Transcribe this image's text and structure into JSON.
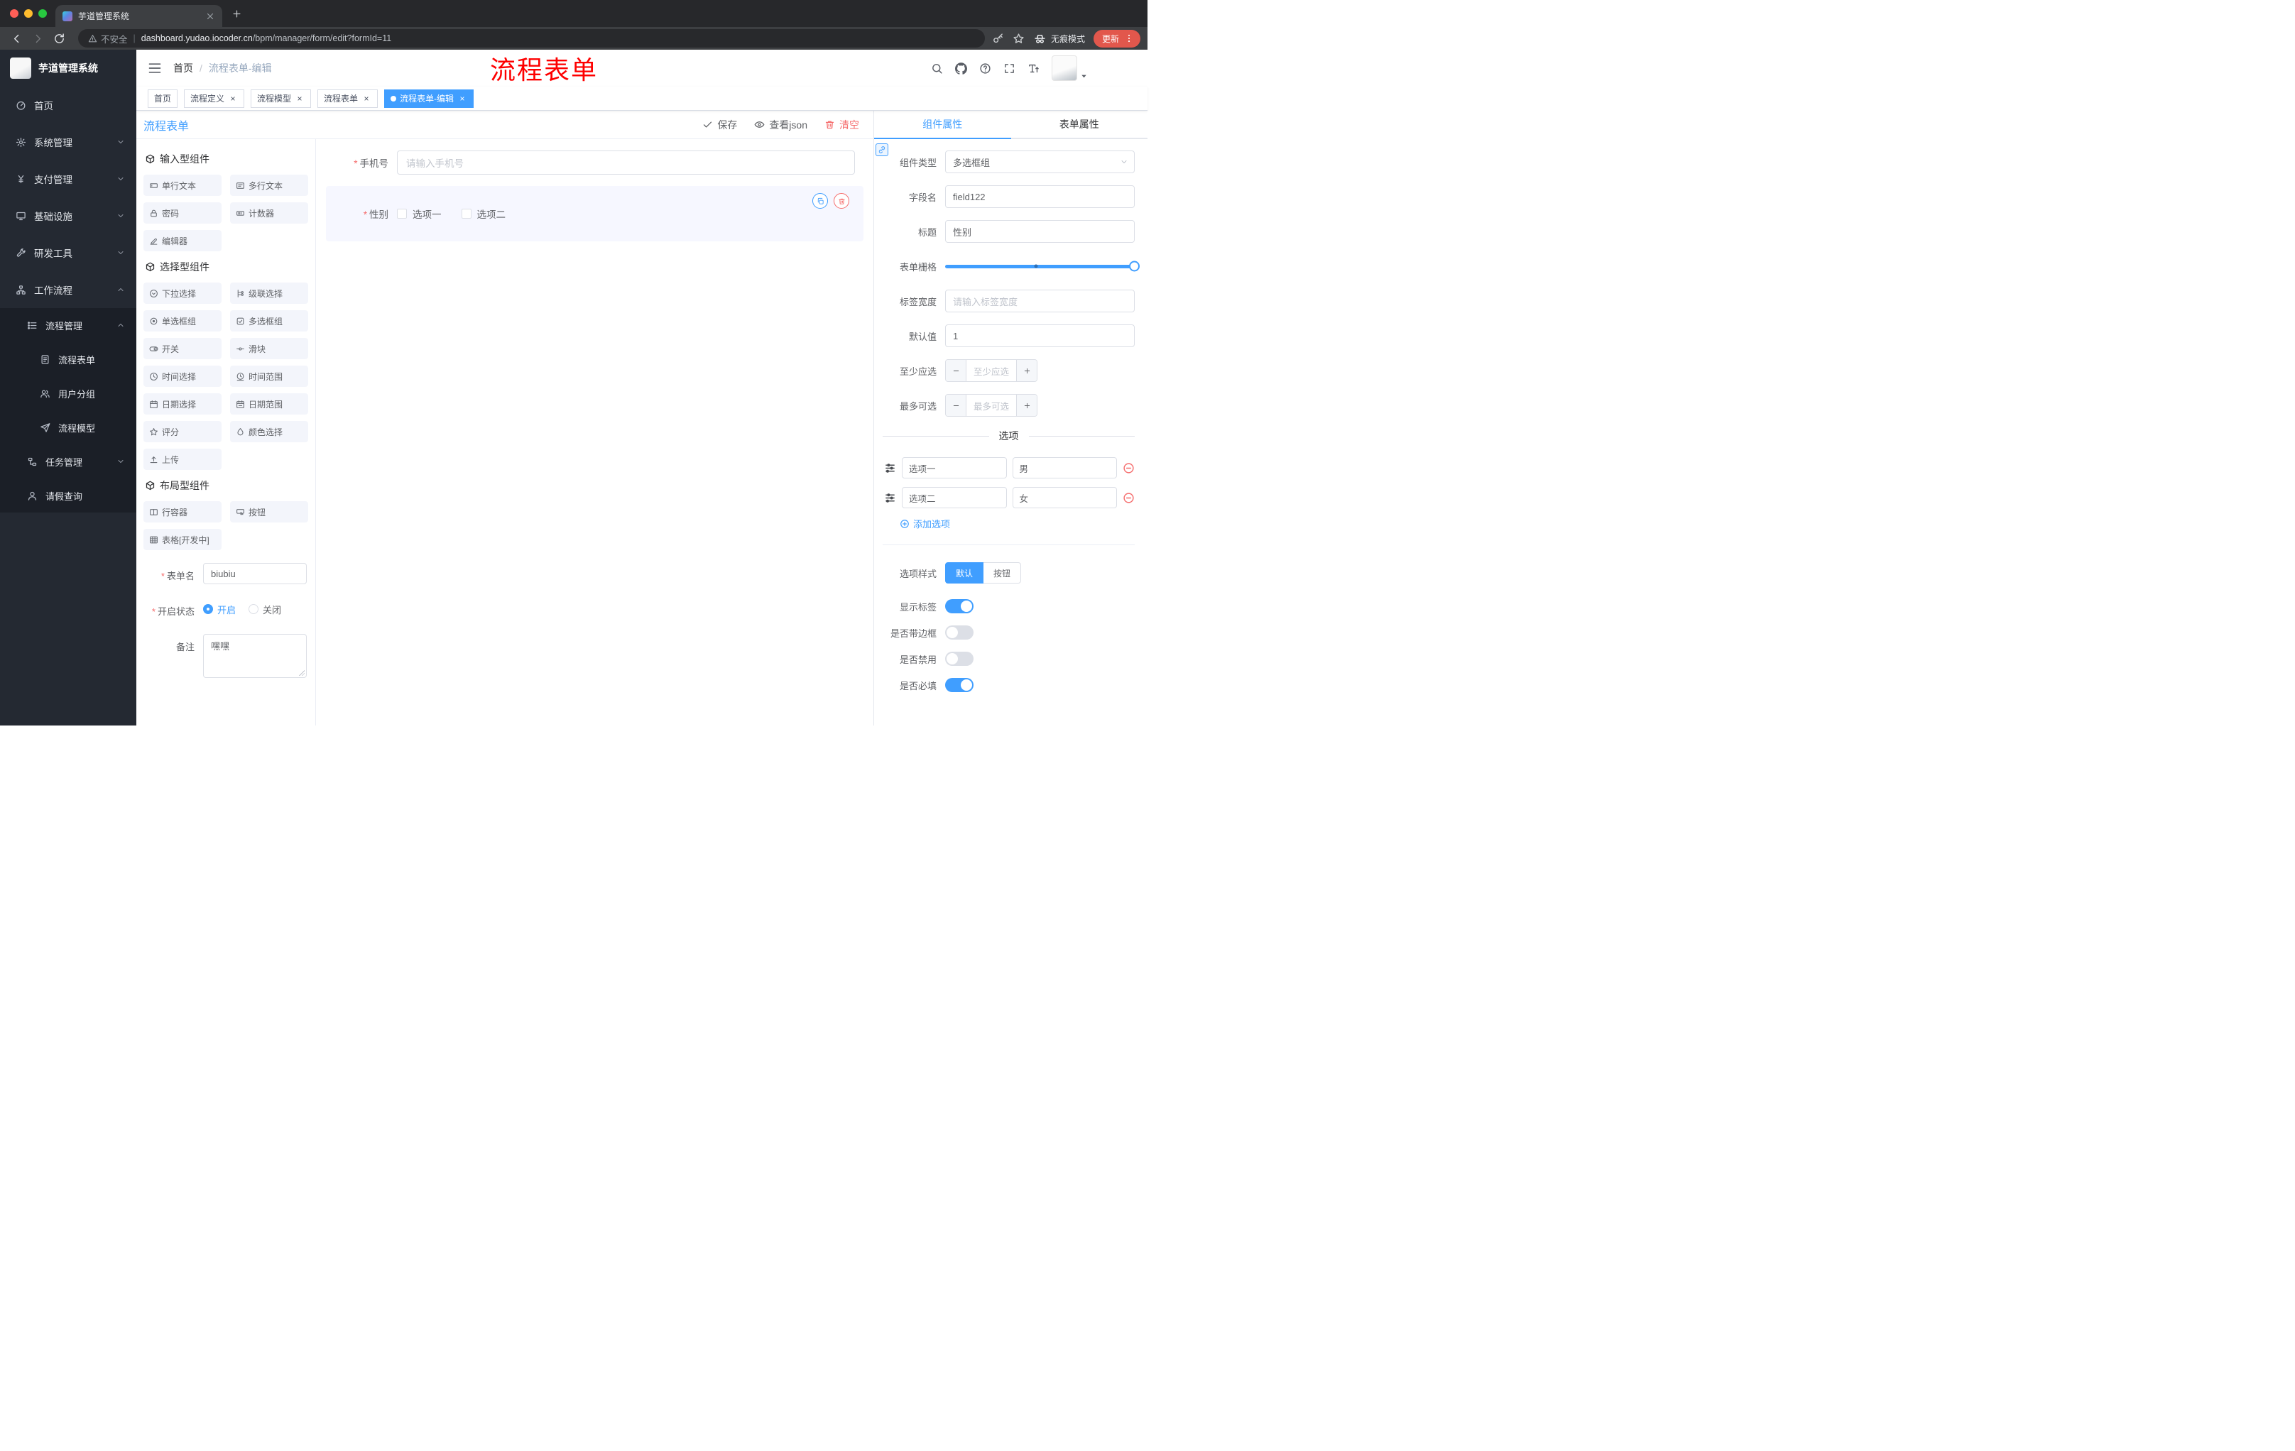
{
  "colors": {
    "accent": "#409eff",
    "danger": "#f56c6c",
    "annotation": "#fe0000"
  },
  "browser": {
    "tab_title": "芋道管理系统",
    "security_label": "不安全",
    "url_domain": "dashboard.yudao.iocoder.cn",
    "url_path": "/bpm/manager/form/edit?formId=11",
    "incognito_label": "无痕模式",
    "update_label": "更新"
  },
  "sidebar": {
    "logo_title": "芋道管理系统",
    "items": [
      {
        "id": "home",
        "label": "首页",
        "icon": "dashboard-icon",
        "level": 1
      },
      {
        "id": "system-manage",
        "label": "系统管理",
        "icon": "gear-icon",
        "level": 1,
        "chevron": "down"
      },
      {
        "id": "payment-manage",
        "label": "支付管理",
        "icon": "yen-icon",
        "level": 1,
        "chevron": "down"
      },
      {
        "id": "infrastructure",
        "label": "基础设施",
        "icon": "monitor-icon",
        "level": 1,
        "chevron": "down"
      },
      {
        "id": "dev-tools",
        "label": "研发工具",
        "icon": "wrench-icon",
        "level": 1,
        "chevron": "down"
      },
      {
        "id": "workflow",
        "label": "工作流程",
        "icon": "sitemap-icon",
        "level": 1,
        "chevron": "up"
      },
      {
        "id": "process-manage",
        "label": "流程管理",
        "icon": "list-icon",
        "level": 2,
        "chevron": "up"
      },
      {
        "id": "process-form",
        "label": "流程表单",
        "icon": "document-icon",
        "level": 3
      },
      {
        "id": "user-group",
        "label": "用户分组",
        "icon": "user-group-icon",
        "level": 3
      },
      {
        "id": "process-model",
        "label": "流程模型",
        "icon": "paper-plane-icon",
        "level": 3
      },
      {
        "id": "task-manage",
        "label": "任务管理",
        "icon": "tree-icon",
        "level": 2,
        "chevron": "down"
      },
      {
        "id": "leave-query",
        "label": "请假查询",
        "icon": "user-icon",
        "level": 2
      }
    ]
  },
  "header": {
    "breadcrumb_home": "首页",
    "breadcrumb_current": "流程表单-编辑",
    "annotation": "流程表单"
  },
  "tags": [
    {
      "id": "home",
      "label": "首页",
      "closable": false,
      "active": false
    },
    {
      "id": "process-definition",
      "label": "流程定义",
      "closable": true,
      "active": false
    },
    {
      "id": "process-model",
      "label": "流程模型",
      "closable": true,
      "active": false
    },
    {
      "id": "process-form",
      "label": "流程表单",
      "closable": true,
      "active": false
    },
    {
      "id": "process-form-edit",
      "label": "流程表单-编辑",
      "closable": true,
      "active": true
    }
  ],
  "designer": {
    "title": "流程表单",
    "save_label": "保存",
    "view_json_label": "查看json",
    "clear_label": "清空"
  },
  "palette": {
    "groups": [
      {
        "title": "输入型组件",
        "items": [
          {
            "label": "单行文本",
            "icon": "input-icon"
          },
          {
            "label": "多行文本",
            "icon": "textarea-icon"
          },
          {
            "label": "密码",
            "icon": "lock-icon"
          },
          {
            "label": "计数器",
            "icon": "counter-icon"
          },
          {
            "label": "编辑器",
            "icon": "editor-icon"
          }
        ]
      },
      {
        "title": "选择型组件",
        "items": [
          {
            "label": "下拉选择",
            "icon": "select-icon"
          },
          {
            "label": "级联选择",
            "icon": "cascader-icon"
          },
          {
            "label": "单选框组",
            "icon": "radio-icon"
          },
          {
            "label": "多选框组",
            "icon": "checkbox-icon"
          },
          {
            "label": "开关",
            "icon": "switch-icon"
          },
          {
            "label": "滑块",
            "icon": "slider-icon"
          },
          {
            "label": "时间选择",
            "icon": "time-icon"
          },
          {
            "label": "时间范围",
            "icon": "time-range-icon"
          },
          {
            "label": "日期选择",
            "icon": "date-icon"
          },
          {
            "label": "日期范围",
            "icon": "date-range-icon"
          },
          {
            "label": "评分",
            "icon": "star-icon"
          },
          {
            "label": "颜色选择",
            "icon": "color-icon"
          },
          {
            "label": "上传",
            "icon": "upload-icon"
          }
        ]
      },
      {
        "title": "布局型组件",
        "items": [
          {
            "label": "行容器",
            "icon": "row-icon"
          },
          {
            "label": "按钮",
            "icon": "button-icon"
          },
          {
            "label": "表格[开发中]",
            "icon": "table-icon"
          }
        ]
      }
    ]
  },
  "form_meta": {
    "name_label": "表单名",
    "name_value": "biubiu",
    "status_label": "开启状态",
    "status_on": "开启",
    "status_off": "关闭",
    "remark_label": "备注",
    "remark_value": "嘿嘿"
  },
  "canvas": {
    "phone_label": "手机号",
    "phone_placeholder": "请输入手机号",
    "gender_label": "性别",
    "gender_options": [
      "选项一",
      "选项二"
    ]
  },
  "props": {
    "tab_component": "组件属性",
    "tab_form": "表单属性",
    "component_type_label": "组件类型",
    "component_type_value": "多选框组",
    "field_name_label": "字段名",
    "field_name_value": "field122",
    "title_label": "标题",
    "title_value": "性别",
    "grid_label": "表单栅格",
    "label_width_label": "标签宽度",
    "label_width_placeholder": "请输入标签宽度",
    "default_label": "默认值",
    "default_value": "1",
    "min_label": "至少应选",
    "min_placeholder": "至少应选",
    "max_label": "最多可选",
    "max_placeholder": "最多可选",
    "options_title": "选项",
    "options": [
      {
        "name": "选项一",
        "value": "男"
      },
      {
        "name": "选项二",
        "value": "女"
      }
    ],
    "add_option_label": "添加选项",
    "style_label": "选项样式",
    "style_options": [
      {
        "label": "默认",
        "active": true
      },
      {
        "label": "按钮",
        "active": false
      }
    ],
    "toggles": [
      {
        "id": "show-label",
        "label": "显示标签",
        "on": true
      },
      {
        "id": "with-border",
        "label": "是否带边框",
        "on": false
      },
      {
        "id": "disabled",
        "label": "是否禁用",
        "on": false
      },
      {
        "id": "required",
        "label": "是否必填",
        "on": true
      }
    ]
  }
}
